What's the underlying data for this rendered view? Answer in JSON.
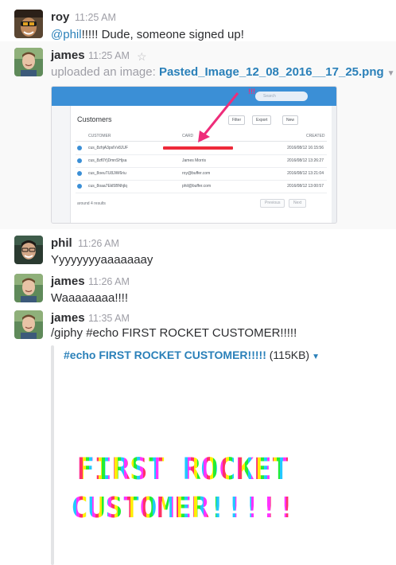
{
  "messages": [
    {
      "author": "roy",
      "time": "11:25 AM",
      "mention": "@phil",
      "text": "!!!!! Dude, someone signed up!",
      "avatar_icon": "roy-avatar"
    },
    {
      "author": "james",
      "time": "11:25 AM",
      "star_icon": "star-icon",
      "upload_prefix": "uploaded an image:",
      "file_name": "Pasted_Image_12_08_2016__17_25.png",
      "avatar_icon": "james-avatar"
    },
    {
      "author": "phil",
      "time": "11:26 AM",
      "text": "Yyyyyyyyaaaaaaay",
      "avatar_icon": "phil-avatar"
    },
    {
      "author": "james",
      "time": "11:26 AM",
      "text": "Waaaaaaaa!!!!",
      "avatar_icon": "james-avatar"
    },
    {
      "author": "james",
      "time": "11:35 AM",
      "text": "/giphy #echo FIRST ROCKET CUSTOMER!!!!!",
      "avatar_icon": "james-avatar"
    }
  ],
  "image_preview": {
    "highlight": "!!!",
    "search_placeholder": "Search",
    "title": "Customers",
    "filter_label": "Filter",
    "export_label": "Export",
    "new_label": "New",
    "columns": [
      "CUSTOMER",
      "CARD",
      "CREATED"
    ],
    "rows": [
      {
        "id": "cus_8zhjA3pslVv8JUF",
        "card": "",
        "created": "2016/08/12 16:15:56"
      },
      {
        "id": "cus_8zf0YjDmnSHjsa",
        "card": "James Morris",
        "created": "2016/08/12 13:26:27"
      },
      {
        "id": "cus_8oeuTU8JiW6riu",
        "card": "roy@buffer.com",
        "created": "2016/08/12 13:21:04"
      },
      {
        "id": "cus_8oaa7Ekl5BNhjlq",
        "card": "phil@buffer.com",
        "created": "2016/08/12 13:00:57"
      }
    ],
    "results": "around 4 results",
    "prev_label": "Previous",
    "next_label": "Next"
  },
  "giphy": {
    "title": "#echo FIRST ROCKET CUSTOMER!!!!!",
    "size": "(115KB)",
    "line1": "FIRST ROCKET",
    "line2": "CUSTOMER!!!!!"
  },
  "colors": {
    "link": "#2a80b9",
    "muted": "#9e9ea6",
    "text": "#2c2d30",
    "highlight_bg": "#f9f9f9"
  }
}
